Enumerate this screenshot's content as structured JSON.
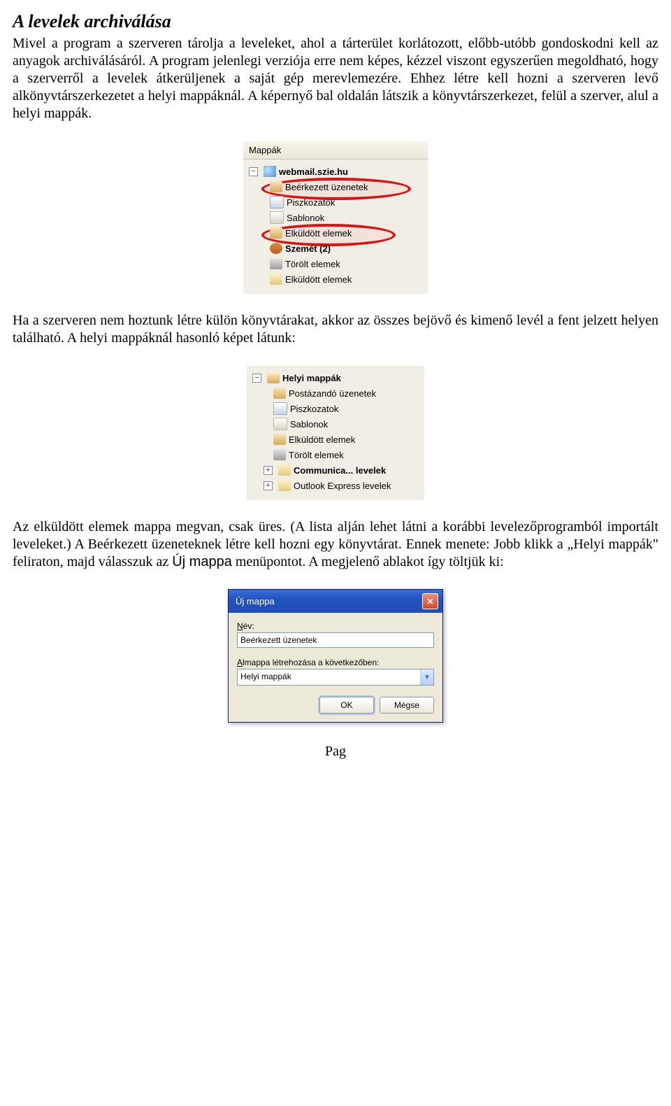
{
  "title": "A levelek archiválása",
  "para1": "Mivel a program a szerveren tárolja a leveleket, ahol a tárterület korlátozott, előbb-utóbb gondoskodni kell az anyagok archiválásáról. A program jelenlegi verziója erre nem képes, kézzel viszont egyszerűen megoldható, hogy a szerverről a levelek átkerüljenek a saját gép merevlemezére. Ehhez létre kell hozni a szerveren levő alkönyvtárszerkezetet a helyi mappáknál. A képernyő bal oldalán látszik a könyvtárszerkezet, felül a szerver, alul a helyi mappák.",
  "para2": "Ha a szerveren nem hoztunk létre külön könyvtárakat, akkor az összes bejövő és kimenő levél a fent jelzett helyen található. A helyi mappáknál hasonló képet látunk:",
  "para3_a": "Az elküldött elemek mappa megvan, csak üres. (A lista alján lehet látni a korábbi levelezőprogramból importált leveleket.) A Beérkezett üzeneteknek létre kell hozni egy könyvtárat. Ennek menete: Jobb klikk a „Helyi mappák\" feliraton, majd válasszuk az ",
  "para3_cmd": "Új mappa",
  "para3_b": " menüpontot. A megjelenő ablakot így töltjük ki:",
  "panel1": {
    "header": "Mappák",
    "root": "webmail.szie.hu",
    "items": [
      {
        "label": "Beérkezett üzenetek",
        "icon": "inbox"
      },
      {
        "label": "Piszkozatok",
        "icon": "draft"
      },
      {
        "label": "Sablonok",
        "icon": "template"
      },
      {
        "label": "Elküldött elemek",
        "icon": "sent"
      },
      {
        "label": "Szemét (2)",
        "icon": "junk",
        "bold": true
      },
      {
        "label": "Törölt elemek",
        "icon": "trash"
      },
      {
        "label": "Elküldött elemek",
        "icon": "folder"
      }
    ]
  },
  "panel2": {
    "root": "Helyi mappák",
    "items": [
      {
        "label": "Postázandó üzenetek",
        "icon": "inbox"
      },
      {
        "label": "Piszkozatok",
        "icon": "draft"
      },
      {
        "label": "Sablonok",
        "icon": "template"
      },
      {
        "label": "Elküldött elemek",
        "icon": "sent"
      },
      {
        "label": "Törölt elemek",
        "icon": "trash"
      },
      {
        "label": "Communica... levelek",
        "icon": "folder",
        "bold": true,
        "expander": "+"
      },
      {
        "label": "Outlook Express levelek",
        "icon": "folder",
        "expander": "+"
      }
    ]
  },
  "dialog": {
    "title": "Új mappa",
    "name_label_u": "N",
    "name_label_rest": "év:",
    "name_value": "Beérkezett üzenetek",
    "sub_label_u": "A",
    "sub_label_rest": "lmappa létrehozása a következőben:",
    "combo_value": "Helyi mappák",
    "ok": "OK",
    "cancel": "Mégse"
  },
  "footer": "Pag"
}
